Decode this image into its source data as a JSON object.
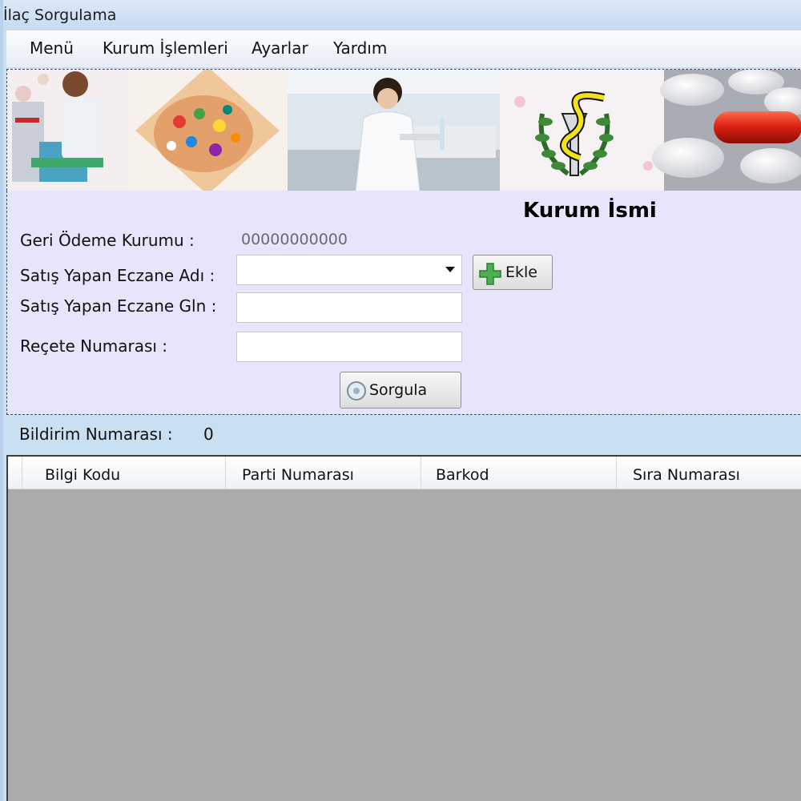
{
  "window": {
    "title": "İlaç Sorgulama"
  },
  "menu": [
    "Menü",
    "Kurum İşlemleri",
    "Ayarlar",
    "Yardım"
  ],
  "form": {
    "heading": "Kurum İsmi",
    "geri_odeme_label": "Geri Ödeme Kurumu :",
    "geri_odeme_value": "00000000000",
    "eczane_adi_label": "Satış Yapan Eczane Adı :",
    "eczane_adi_value": "",
    "eczane_gln_label": "Satış Yapan Eczane Gln :",
    "eczane_gln_value": "",
    "recete_label": "Reçete Numarası :",
    "recete_value": "",
    "ekle_label": "Ekle",
    "sorgula_label": "Sorgula"
  },
  "status": {
    "bildirim_label": "Bildirim Numarası :",
    "bildirim_value": "0"
  },
  "grid": {
    "columns": [
      "Bilgi Kodu",
      "Parti Numarası",
      "Barkod",
      "Sıra Numarası"
    ],
    "rows": []
  },
  "colors": {
    "titlebar": "#c5dbf1",
    "form_background": "#e6e5fb",
    "grid_background": "#ababab"
  },
  "icons": {
    "ekle": "plus-icon",
    "sorgula": "search-disc-icon",
    "dropdown": "chevron-down-icon"
  }
}
